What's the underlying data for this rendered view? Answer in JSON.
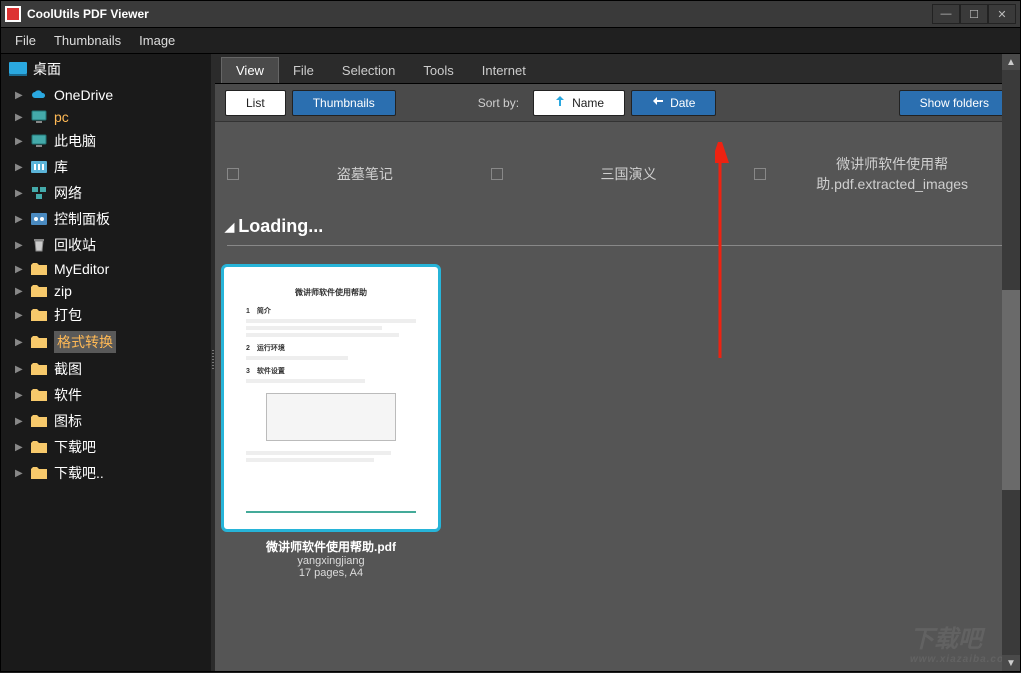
{
  "window": {
    "title": "CoolUtils PDF Viewer"
  },
  "menubar": [
    "File",
    "Thumbnails",
    "Image"
  ],
  "sidebar": {
    "root": "桌面",
    "items": [
      {
        "label": "OneDrive",
        "icon": "cloud",
        "color": "#1e90ff"
      },
      {
        "label": "pc",
        "icon": "pc",
        "highlight": true
      },
      {
        "label": "此电脑",
        "icon": "pc"
      },
      {
        "label": "库",
        "icon": "folder-lib"
      },
      {
        "label": "网络",
        "icon": "network"
      },
      {
        "label": "控制面板",
        "icon": "control"
      },
      {
        "label": "回收站",
        "icon": "recycle"
      },
      {
        "label": "MyEditor",
        "icon": "folder"
      },
      {
        "label": "zip",
        "icon": "folder"
      },
      {
        "label": "打包",
        "icon": "folder"
      },
      {
        "label": "格式转换",
        "icon": "folder",
        "selected": true,
        "highlight": true
      },
      {
        "label": "截图",
        "icon": "folder"
      },
      {
        "label": "软件",
        "icon": "folder"
      },
      {
        "label": "图标",
        "icon": "folder"
      },
      {
        "label": "下载吧",
        "icon": "folder"
      },
      {
        "label": "下载吧..",
        "icon": "folder"
      }
    ]
  },
  "tabs": [
    "View",
    "File",
    "Selection",
    "Tools",
    "Internet"
  ],
  "toolbar": {
    "list_label": "List",
    "thumbs_label": "Thumbnails",
    "sort_label": "Sort by:",
    "name_label": "Name",
    "date_label": "Date",
    "showfolders_label": "Show folders"
  },
  "folders_row": [
    {
      "name": "盗墓笔记"
    },
    {
      "name": "三国演义"
    },
    {
      "name": "微讲师软件使用帮助.pdf.extracted_images"
    }
  ],
  "loading_label": "Loading...",
  "thumbnail": {
    "filename": "微讲师软件使用帮助.pdf",
    "author": "yangxingjiang",
    "pages": "17 pages, A4"
  },
  "watermark": {
    "big": "下载吧",
    "small": "www.xiazaiba.com"
  }
}
